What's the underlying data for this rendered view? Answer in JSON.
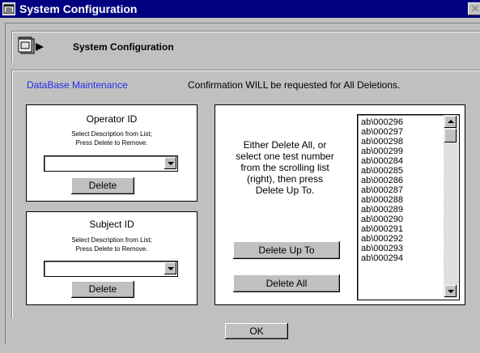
{
  "window": {
    "title": "System Configuration",
    "close_glyph": "✕"
  },
  "header": {
    "title": "System Configuration",
    "icon": "computer-window-icon"
  },
  "main": {
    "section_label": "DataBase Maintenance",
    "confirmation": "Confirmation WILL be requested for All Deletions.",
    "accent_color": "#1e2ee8"
  },
  "operator": {
    "title": "Operator ID",
    "hint_line1": "Select Description from List;",
    "hint_line2": "Press Delete to Remove.",
    "selected_value": "",
    "delete_label": "Delete"
  },
  "subject": {
    "title": "Subject ID",
    "hint_line1": "Select Description from List;",
    "hint_line2": "Press Delete to Remove.",
    "selected_value": "",
    "delete_label": "Delete"
  },
  "tests": {
    "instructions": [
      "Either Delete All, or",
      "select one test number",
      "from the scrolling list",
      "(right), then press",
      "Delete Up To."
    ],
    "delete_up_to_label": "Delete Up To",
    "delete_all_label": "Delete All",
    "items": [
      "ab\\000296",
      "ab\\000297",
      "ab\\000298",
      "ab\\000299",
      "ab\\000284",
      "ab\\000285",
      "ab\\000286",
      "ab\\000287",
      "ab\\000288",
      "ab\\000289",
      "ab\\000290",
      "ab\\000291",
      "ab\\000292",
      "ab\\000293",
      "ab\\000294"
    ]
  },
  "footer": {
    "ok_label": "OK"
  }
}
